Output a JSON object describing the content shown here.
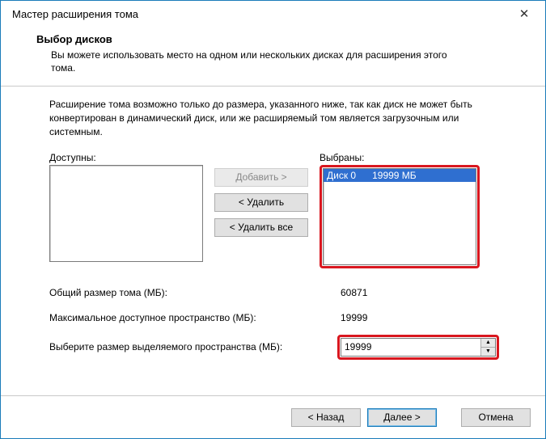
{
  "window": {
    "title": "Мастер расширения тома",
    "close_icon": "✕"
  },
  "header": {
    "title": "Выбор дисков",
    "desc": "Вы можете использовать место на одном или нескольких дисках для расширения этого тома."
  },
  "note": "Расширение тома возможно только до размера, указанного ниже, так как диск не может быть конвертирован в динамический диск, или же расширяемый том является загрузочным или системным.",
  "lists": {
    "available_label": "Доступны:",
    "selected_label": "Выбраны:",
    "selected_item": "Диск 0      19999 МБ"
  },
  "buttons": {
    "add": "Добавить >",
    "remove": "< Удалить",
    "remove_all": "< Удалить все"
  },
  "fields": {
    "total_label": "Общий размер тома (МБ):",
    "total_value": "60871",
    "max_label": "Максимальное доступное пространство (МБ):",
    "max_value": "19999",
    "select_label": "Выберите размер выделяемого пространства (МБ):",
    "select_value": "19999"
  },
  "footer": {
    "back": "< Назад",
    "next": "Далее >",
    "cancel": "Отмена"
  }
}
